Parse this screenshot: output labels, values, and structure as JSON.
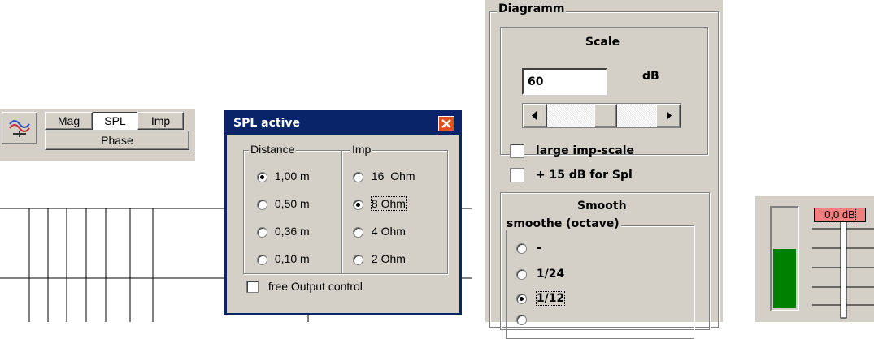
{
  "toolbar": {
    "tabs": [
      {
        "label": "Mag",
        "active": false
      },
      {
        "label": "SPL",
        "active": true
      },
      {
        "label": "Imp",
        "active": false
      }
    ],
    "phase_label": "Phase",
    "icon": "speaker-mesh-icon"
  },
  "spl_dialog": {
    "title": "SPL active",
    "distance_legend": "Distance",
    "imp_legend": "Imp",
    "distances": [
      {
        "label": "1,00 m",
        "selected": true
      },
      {
        "label": "0,50 m",
        "selected": false
      },
      {
        "label": "0,36 m",
        "selected": false
      },
      {
        "label": "0,10 m",
        "selected": false
      }
    ],
    "impedances": [
      {
        "label": "16  Ohm",
        "selected": false
      },
      {
        "label": "8 Ohm",
        "selected": true
      },
      {
        "label": "4 Ohm",
        "selected": false
      },
      {
        "label": "2 Ohm",
        "selected": false
      }
    ],
    "free_output_label": "free Output control",
    "free_output_checked": false,
    "title_bar_color": "#0a246a",
    "close_button_color": "#e35020"
  },
  "diagramm": {
    "legend": "Diagramm",
    "scale_label": "Scale",
    "scale_value": "60",
    "scale_unit": "dB",
    "slider_level": 0.55,
    "large_imp_label": "large imp-scale",
    "large_imp_checked": false,
    "spl_plus_label": "+ 15 dB for Spl",
    "spl_plus_checked": false,
    "smooth_label": "Smooth",
    "smooth_legend": "smoothe (octave)",
    "smooth_options": [
      {
        "label": "-",
        "selected": false
      },
      {
        "label": "1/24",
        "selected": false
      },
      {
        "label": "1/12",
        "selected": true
      }
    ]
  },
  "meter": {
    "level_fraction": 0.6,
    "fader_label": "0,0 dB",
    "level_color": "#008000",
    "fader_label_color": "#f08080"
  }
}
